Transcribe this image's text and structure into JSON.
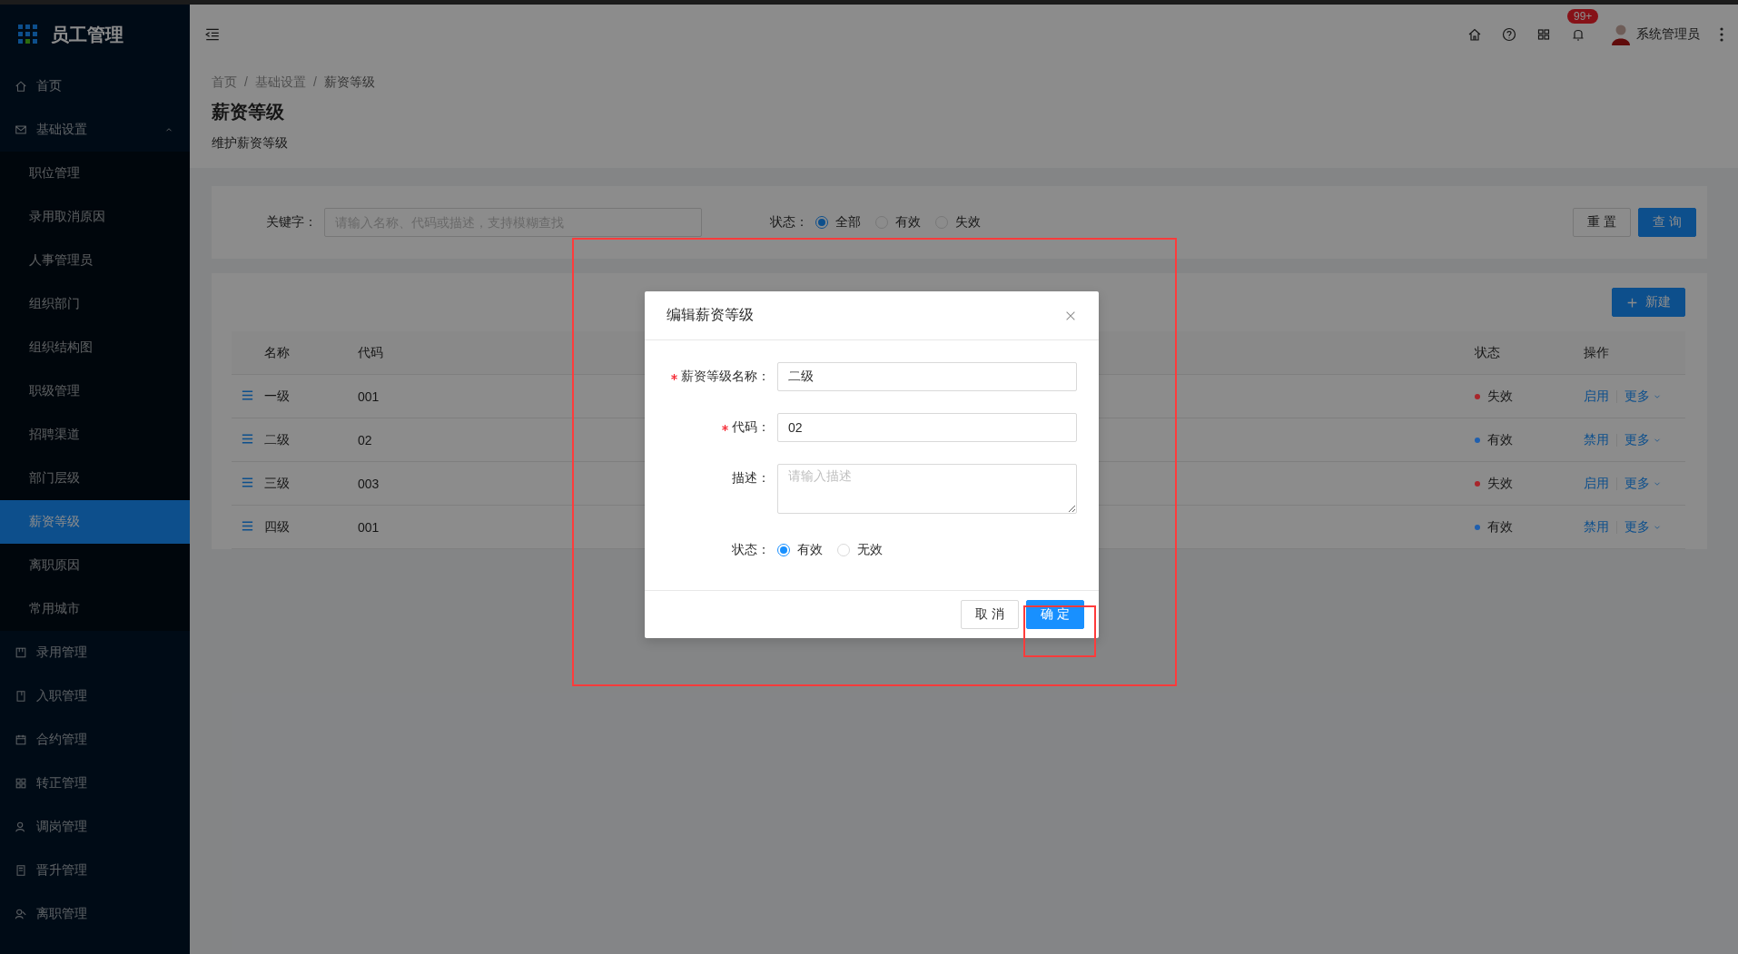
{
  "sidebar": {
    "logo": "员工管理",
    "items": [
      {
        "kind": "link",
        "label": "首页",
        "selected": false
      },
      {
        "kind": "group",
        "label": "基础设置",
        "selected": false,
        "expanded": true,
        "children": [
          {
            "label": "职位管理",
            "selected": false
          },
          {
            "label": "录用取消原因",
            "selected": false
          },
          {
            "label": "人事管理员",
            "selected": false
          },
          {
            "label": "组织部门",
            "selected": false
          },
          {
            "label": "组织结构图",
            "selected": false
          },
          {
            "label": "职级管理",
            "selected": false
          },
          {
            "label": "招聘渠道",
            "selected": false
          },
          {
            "label": "部门层级",
            "selected": false
          },
          {
            "label": "薪资等级",
            "selected": true
          },
          {
            "label": "离职原因",
            "selected": false
          },
          {
            "label": "常用城市",
            "selected": false
          }
        ]
      },
      {
        "kind": "link",
        "label": "录用管理",
        "selected": false
      },
      {
        "kind": "link",
        "label": "入职管理",
        "selected": false
      },
      {
        "kind": "link",
        "label": "合约管理",
        "selected": false
      },
      {
        "kind": "link",
        "label": "转正管理",
        "selected": false
      },
      {
        "kind": "link",
        "label": "调岗管理",
        "selected": false
      },
      {
        "kind": "link",
        "label": "晋升管理",
        "selected": false
      },
      {
        "kind": "link",
        "label": "离职管理",
        "selected": false
      }
    ]
  },
  "header": {
    "notification_badge": "99+",
    "user_name": "系统管理员"
  },
  "page_header": {
    "breadcrumb": [
      "首页",
      "基础设置",
      "薪资等级"
    ],
    "separator": "/",
    "title": "薪资等级",
    "subtitle": "维护薪资等级"
  },
  "filter": {
    "keyword_label": "关键字：",
    "keyword_placeholder": "请输入名称、代码或描述，支持模糊查找",
    "status_label": "状态：",
    "status_options": [
      {
        "label": "全部",
        "selected": true
      },
      {
        "label": "有效",
        "selected": false
      },
      {
        "label": "失效",
        "selected": false
      }
    ],
    "buttons": [
      {
        "kind": "default",
        "label": "重 置"
      },
      {
        "kind": "primary",
        "label": "查 询"
      }
    ]
  },
  "table": {
    "new_button": "新建",
    "columns": [
      "名称",
      "代码",
      "状态",
      "操作"
    ],
    "rows": [
      {
        "name": "一级",
        "code": "001",
        "status": "失效",
        "color": "#a8262b",
        "actions": [
          "启用",
          "更多"
        ]
      },
      {
        "name": "二级",
        "code": "02",
        "status": "有效",
        "color": "#1f5fae",
        "actions": [
          "禁用",
          "更多"
        ]
      },
      {
        "name": "三级",
        "code": "003",
        "status": "失效",
        "color": "#a8262b",
        "actions": [
          "启用",
          "更多"
        ]
      },
      {
        "name": "四级",
        "code": "001",
        "status": "有效",
        "color": "#1f5fae",
        "actions": [
          "禁用",
          "更多"
        ]
      }
    ]
  },
  "modal": {
    "title": "编辑薪资等级",
    "fields": [
      {
        "kind": "input",
        "label": "薪资等级名称：",
        "required": true,
        "value": "二级"
      },
      {
        "kind": "input",
        "label": "代码：",
        "required": true,
        "value": "02"
      },
      {
        "kind": "textarea",
        "label": "描述：",
        "required": false,
        "placeholder": "请输入描述"
      },
      {
        "kind": "radio",
        "label": "状态：",
        "required": false,
        "options": [
          {
            "label": "有效",
            "selected": true
          },
          {
            "label": "无效",
            "selected": false
          }
        ]
      }
    ],
    "buttons": [
      {
        "kind": "default",
        "label": "取 消"
      },
      {
        "kind": "primary",
        "label": "确 定"
      }
    ]
  }
}
